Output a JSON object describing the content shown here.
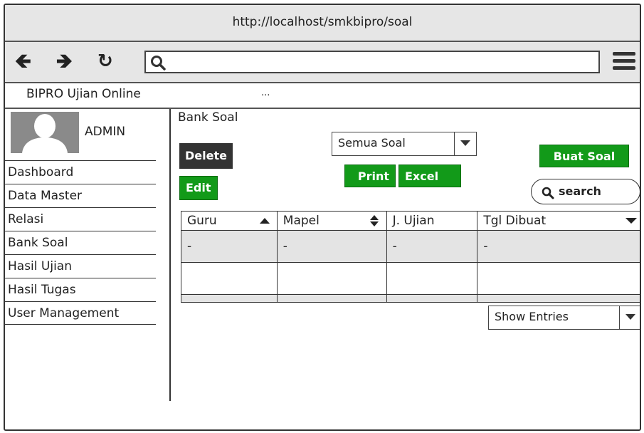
{
  "browser": {
    "url_title": "http://localhost/smkbipro/soal",
    "address_value": ""
  },
  "app": {
    "name": "BIPRO Ujian Online",
    "dots": "..."
  },
  "sidebar": {
    "user": "ADMIN",
    "items": [
      {
        "label": "Dashboard"
      },
      {
        "label": "Data Master"
      },
      {
        "label": "Relasi"
      },
      {
        "label": "Bank Soal"
      },
      {
        "label": "Hasil Ujian"
      },
      {
        "label": "Hasil Tugas"
      },
      {
        "label": "User Management"
      }
    ]
  },
  "main": {
    "title": "Bank Soal",
    "delete_label": "Delete",
    "edit_label": "Edit",
    "filter_value": "Semua Soal",
    "print_label": "Print",
    "excel_label": "Excel",
    "create_label": "Buat Soal",
    "search_label": "search",
    "columns": [
      "Guru",
      "Mapel",
      "J. Ujian",
      "Tgl Dibuat"
    ],
    "rows": [
      [
        "-",
        "-",
        "-",
        "-"
      ]
    ],
    "entries_label": "Show Entries"
  },
  "colors": {
    "accent_green": "#129a19",
    "dark_button": "#333333"
  }
}
